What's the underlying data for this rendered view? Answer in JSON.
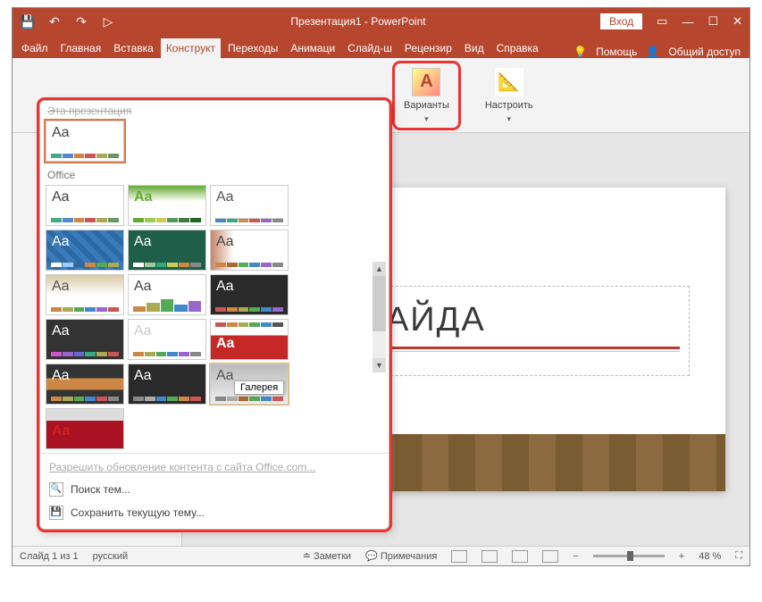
{
  "title": "Презентация1 - PowerPoint",
  "qat": {
    "save": "💾",
    "undo": "↶",
    "redo": "↷",
    "start": "▷"
  },
  "login_label": "Вход",
  "tabs": {
    "file": "Файл",
    "home": "Главная",
    "insert": "Вставка",
    "design": "Конструкт",
    "transitions": "Переходы",
    "animations": "Анимаци",
    "slideshow": "Слайд-ш",
    "review": "Рецензир",
    "view": "Вид",
    "help": "Справка"
  },
  "ribbon_right": {
    "tell_me": "Помощь",
    "share": "Общий доступ"
  },
  "ribbon_groups": {
    "variants": "Варианты",
    "customize": "Настроить"
  },
  "dropdown": {
    "section_current": "Эта презентация",
    "section_office": "Office",
    "tooltip": "Галерея",
    "enable_updates": "Разрешить обновление контента с сайта Office.com...",
    "browse_themes": "Поиск тем...",
    "save_theme": "Сохранить текущую тему..."
  },
  "slide": {
    "title": "ВОК СЛАЙДА"
  },
  "statusbar": {
    "slide_count": "Слайд 1 из 1",
    "lang": "русский",
    "notes": "Заметки",
    "comments": "Примечания",
    "zoom": "48 %"
  }
}
